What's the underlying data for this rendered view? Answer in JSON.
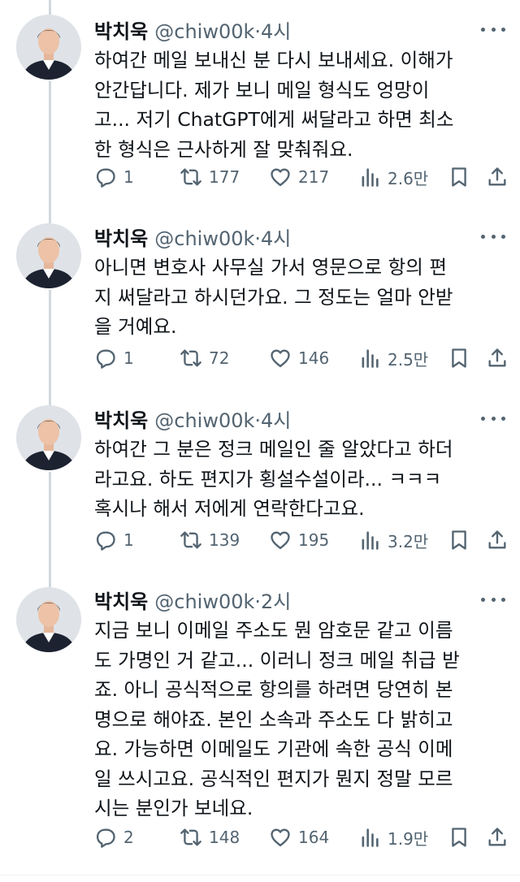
{
  "tweets": [
    {
      "name": "박치욱",
      "handle": "@chiw00k·4시",
      "lines": [
        "하여간 메일 보내신 분 다시 보내세요. 이해가",
        "안간답니다. 제가 보니 메일 형식도 엉망이",
        "고... 저기 ChatGPT에게 써달라고 하면 최소",
        "한 형식은 근사하게 잘 맞춰줘요."
      ],
      "replies": "1",
      "retweets": "177",
      "likes": "217",
      "views": "2.6만"
    },
    {
      "name": "박치욱",
      "handle": "@chiw00k·4시",
      "lines": [
        "아니면 변호사 사무실 가서 영문으로 항의 편",
        "지 써달라고 하시던가요. 그 정도는 얼마 안받",
        "을 거예요."
      ],
      "replies": "1",
      "retweets": "72",
      "likes": "146",
      "views": "2.5만"
    },
    {
      "name": "박치욱",
      "handle": "@chiw00k·4시",
      "lines": [
        "하여간 그 분은 정크 메일인 줄 알았다고 하더",
        "라고요. 하도 편지가 횡설수설이라... ㅋㅋㅋ",
        "혹시나 해서 저에게 연락한다고요."
      ],
      "replies": "1",
      "retweets": "139",
      "likes": "195",
      "views": "3.2만"
    },
    {
      "name": "박치욱",
      "handle": "@chiw00k·2시",
      "lines": [
        "지금 보니 이메일 주소도 뭔 암호문 같고 이름",
        "도 가명인 거 같고... 이러니 정크 메일 취급 받",
        "죠. 아니 공식적으로 항의를 하려면 당연히 본",
        "명으로 해야죠. 본인 소속과 주소도 다 밝히고",
        "요. 가능하면 이메일도 기관에 속한 공식 이메",
        "일 쓰시고요. 공식적인 편지가 뭔지 정말 모르",
        "시는 분인가 보네요."
      ],
      "replies": "2",
      "retweets": "148",
      "likes": "164",
      "views": "1.9만"
    }
  ],
  "colors": {
    "text": "#0f1419",
    "muted": "#536471",
    "thread_line": "#cfd9de"
  }
}
